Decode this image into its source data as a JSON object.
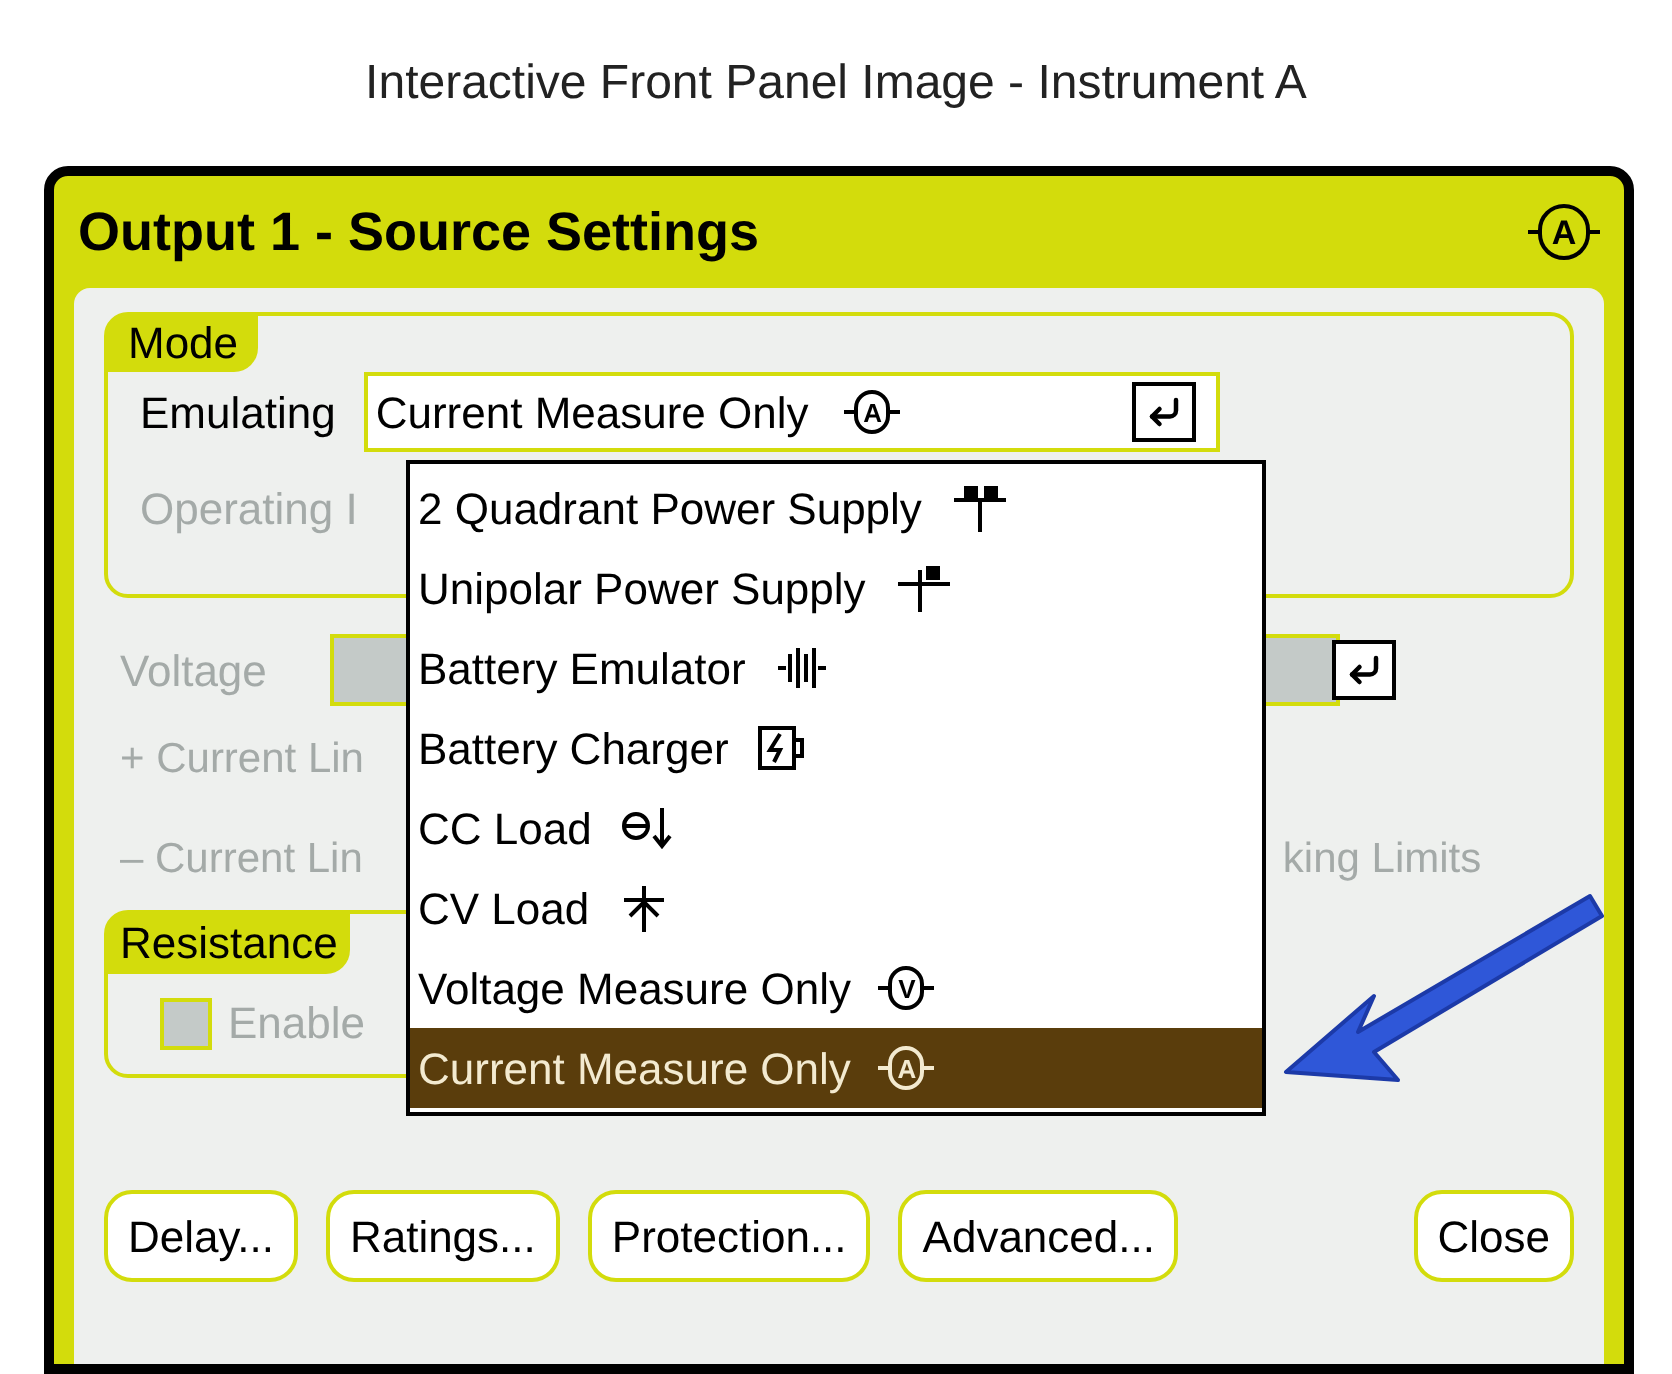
{
  "caption": "Interactive Front Panel Image - Instrument A",
  "dialog": {
    "title": "Output 1 - Source Settings",
    "title_badge": "A"
  },
  "mode": {
    "label": "Mode",
    "emulating_label": "Emulating",
    "value": "Current Measure Only",
    "value_badge": "A",
    "operating_label": "Operating I"
  },
  "dropdown": [
    {
      "label": "2 Quadrant Power Supply",
      "kind": "two-quadrant",
      "selected": false
    },
    {
      "label": "Unipolar Power Supply",
      "kind": "unipolar",
      "selected": false
    },
    {
      "label": "Battery Emulator",
      "kind": "battery",
      "selected": false
    },
    {
      "label": "Battery Charger",
      "kind": "charger",
      "selected": false
    },
    {
      "label": "CC Load",
      "kind": "cc-load",
      "selected": false
    },
    {
      "label": "CV Load",
      "kind": "cv-load",
      "selected": false
    },
    {
      "label": "Voltage Measure Only",
      "kind": "meter",
      "badge": "V",
      "selected": false
    },
    {
      "label": "Current Measure Only",
      "kind": "meter",
      "badge": "A",
      "selected": true
    }
  ],
  "settings_disabled": true,
  "voltage_label": "Voltage",
  "plus_current_label": "+ Current Lin",
  "minus_current_label": "– Current Lin",
  "tracking_fragment": "king Limits",
  "resistance": {
    "label": "Resistance",
    "enable_label": "Enable",
    "checked": false
  },
  "buttons": [
    "Delay...",
    "Ratings...",
    "Protection...",
    "Advanced...",
    "Close"
  ]
}
